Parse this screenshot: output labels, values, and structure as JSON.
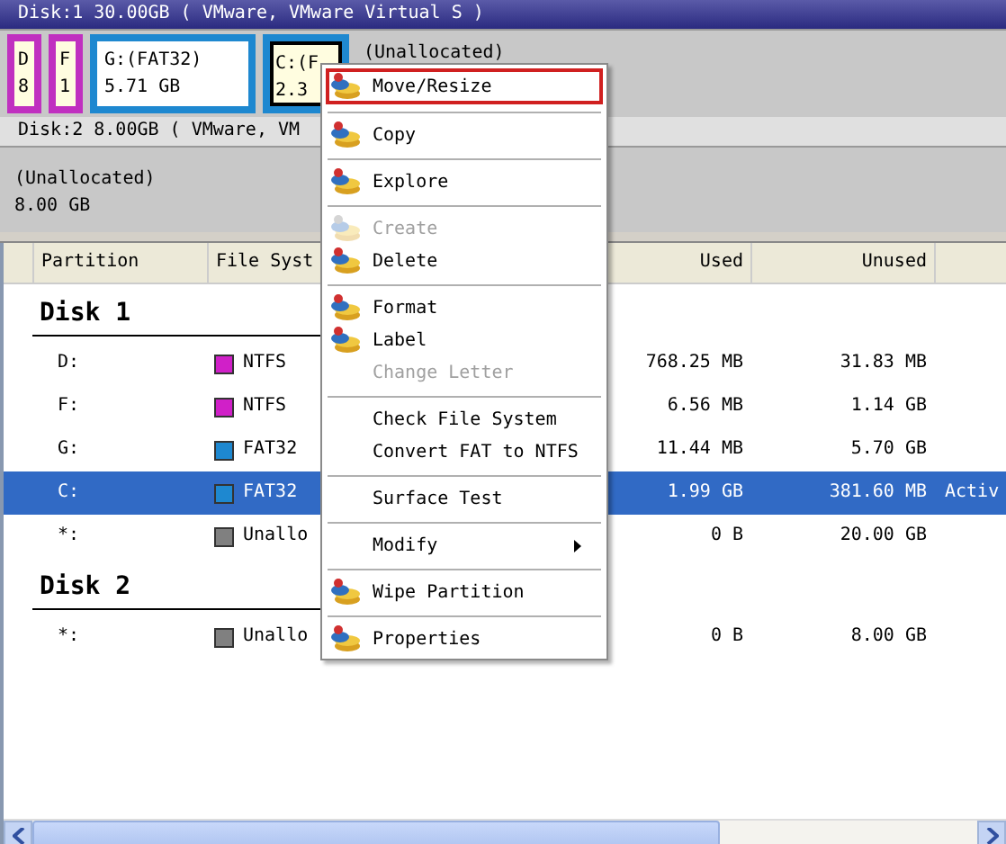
{
  "disk_map": [
    {
      "title": "Disk:1 30.00GB ( VMware, VMware Virtual S )",
      "selected": true,
      "partitions": [
        {
          "kind": "partition",
          "color": "#c030c0",
          "lines": [
            "D",
            "8"
          ],
          "selected": false
        },
        {
          "kind": "partition",
          "color": "#c030c0",
          "lines": [
            "F",
            "1"
          ],
          "selected": false
        },
        {
          "kind": "partition",
          "color": "#1e88d0",
          "lines": [
            "G:(FAT32)",
            "5.71 GB"
          ],
          "selected": false
        },
        {
          "kind": "partition",
          "color": "#1e88d0",
          "lines": [
            "C:(F",
            "2.3"
          ],
          "selected": true
        },
        {
          "kind": "unallocated",
          "lines": [
            "(Unallocated)"
          ],
          "selected": false
        }
      ]
    },
    {
      "title": "Disk:2 8.00GB ( VMware, VM",
      "selected": false,
      "partitions": [
        {
          "kind": "unallocated",
          "lines": [
            "(Unallocated)",
            "8.00 GB"
          ],
          "selected": false
        }
      ]
    }
  ],
  "table": {
    "columns": [
      "Partition",
      "File Syst",
      "Used",
      "Unused"
    ],
    "disks": [
      {
        "title": "Disk 1",
        "rows": [
          {
            "partition": "D:",
            "color": "#d020c8",
            "file_system": "NTFS",
            "used": "768.25 MB",
            "unused": "31.83 MB",
            "status": "",
            "selected": false
          },
          {
            "partition": "F:",
            "color": "#d020c8",
            "file_system": "NTFS",
            "used": "6.56 MB",
            "unused": "1.14 GB",
            "status": "",
            "selected": false
          },
          {
            "partition": "G:",
            "color": "#1e88d0",
            "file_system": "FAT32",
            "used": "11.44 MB",
            "unused": "5.70 GB",
            "status": "",
            "selected": false
          },
          {
            "partition": "C:",
            "color": "#1e88d0",
            "file_system": "FAT32",
            "used": "1.99 GB",
            "unused": "381.60 MB",
            "status": "Activ",
            "selected": true
          },
          {
            "partition": "*:",
            "color": "#808080",
            "file_system": "Unallo",
            "used": "0 B",
            "unused": "20.00 GB",
            "status": "",
            "selected": false
          }
        ]
      },
      {
        "title": "Disk 2",
        "rows": [
          {
            "partition": "*:",
            "color": "#808080",
            "file_system": "Unallo",
            "used": "0 B",
            "unused": "8.00 GB",
            "status": "",
            "selected": false
          }
        ]
      }
    ]
  },
  "context_menu": [
    {
      "kind": "item",
      "label": "Move/Resize",
      "icon": true,
      "disabled": false,
      "highlighted": true,
      "submenu": false
    },
    {
      "kind": "separator"
    },
    {
      "kind": "item",
      "label": "Copy",
      "icon": true,
      "disabled": false,
      "highlighted": false,
      "submenu": false
    },
    {
      "kind": "separator"
    },
    {
      "kind": "item",
      "label": "Explore",
      "icon": true,
      "disabled": false,
      "highlighted": false,
      "submenu": false
    },
    {
      "kind": "separator"
    },
    {
      "kind": "item",
      "label": "Create",
      "icon": true,
      "disabled": true,
      "highlighted": false,
      "submenu": false
    },
    {
      "kind": "item",
      "label": "Delete",
      "icon": true,
      "disabled": false,
      "highlighted": false,
      "submenu": false
    },
    {
      "kind": "separator"
    },
    {
      "kind": "item",
      "label": "Format",
      "icon": true,
      "disabled": false,
      "highlighted": false,
      "submenu": false
    },
    {
      "kind": "item",
      "label": "Label",
      "icon": true,
      "disabled": false,
      "highlighted": false,
      "submenu": false
    },
    {
      "kind": "item",
      "label": "Change Letter",
      "icon": false,
      "disabled": true,
      "highlighted": false,
      "submenu": false
    },
    {
      "kind": "separator"
    },
    {
      "kind": "item",
      "label": "Check File System",
      "icon": false,
      "disabled": false,
      "highlighted": false,
      "submenu": false
    },
    {
      "kind": "item",
      "label": "Convert FAT to NTFS",
      "icon": false,
      "disabled": false,
      "highlighted": false,
      "submenu": false
    },
    {
      "kind": "separator"
    },
    {
      "kind": "item",
      "label": "Surface Test",
      "icon": false,
      "disabled": false,
      "highlighted": false,
      "submenu": false
    },
    {
      "kind": "separator"
    },
    {
      "kind": "item",
      "label": "Modify",
      "icon": false,
      "disabled": false,
      "highlighted": false,
      "submenu": true
    },
    {
      "kind": "separator"
    },
    {
      "kind": "item",
      "label": "Wipe Partition",
      "icon": true,
      "disabled": false,
      "highlighted": false,
      "submenu": false
    },
    {
      "kind": "separator"
    },
    {
      "kind": "item",
      "label": "Properties",
      "icon": true,
      "disabled": false,
      "highlighted": false,
      "submenu": false
    }
  ]
}
